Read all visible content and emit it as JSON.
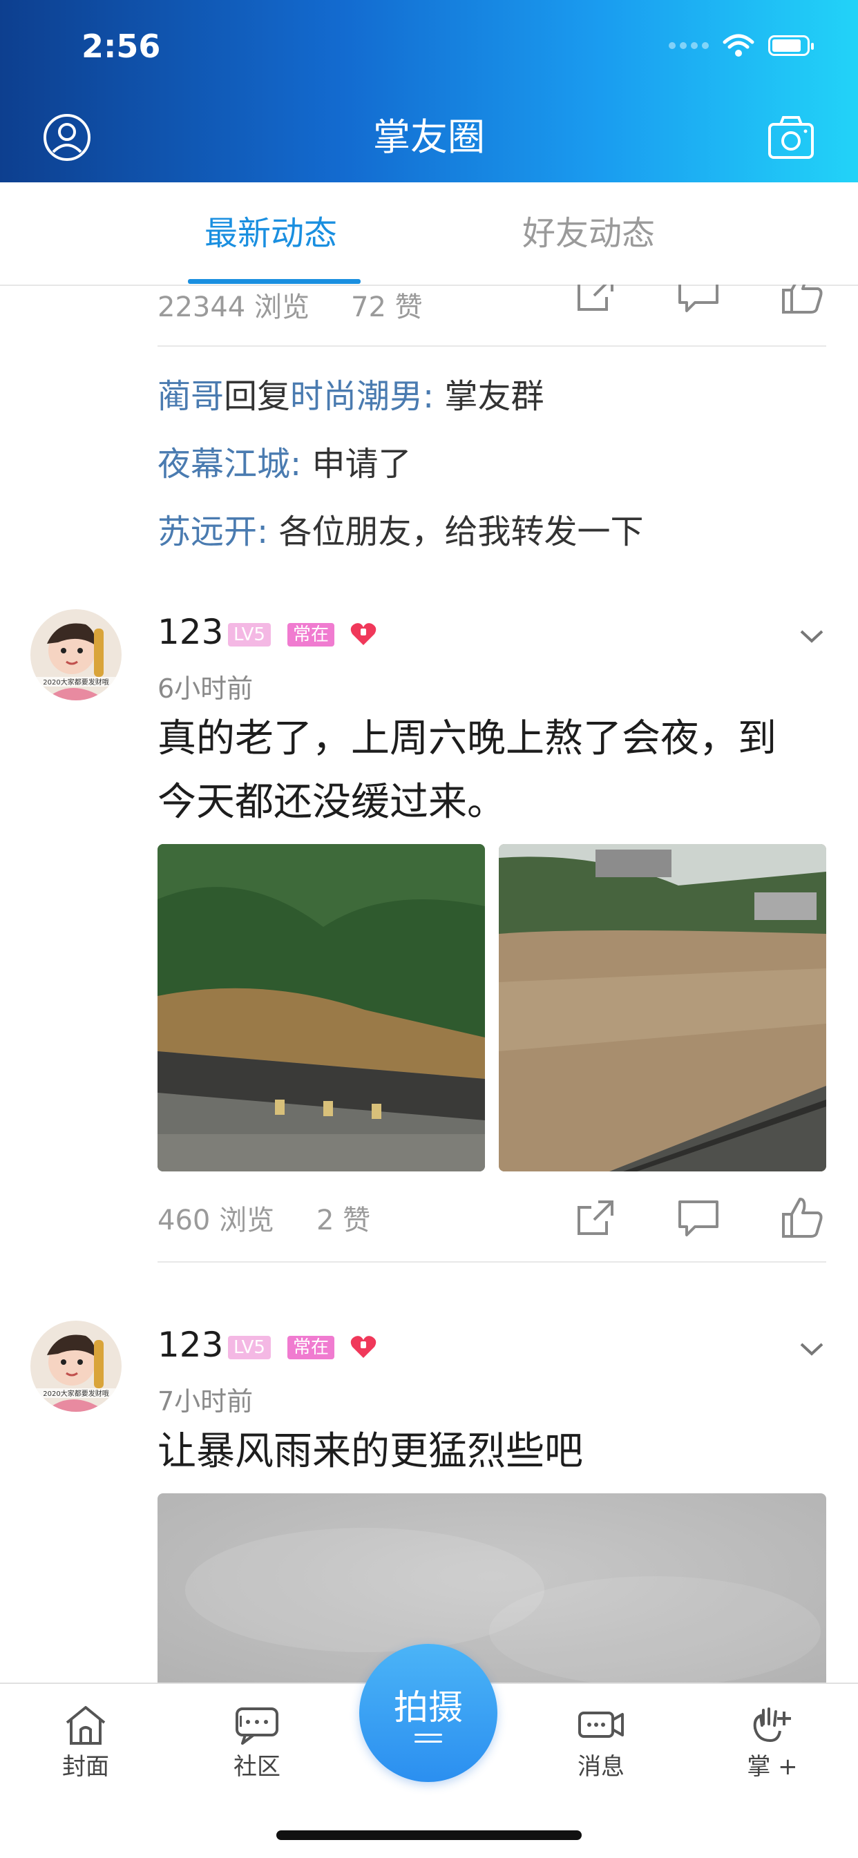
{
  "status_bar": {
    "time": "2:56"
  },
  "header": {
    "title": "掌友圈"
  },
  "tabs": [
    {
      "label": "最新动态",
      "active": true
    },
    {
      "label": "好友动态",
      "active": false
    }
  ],
  "feed": {
    "prev_post": {
      "views": "22344 浏览",
      "likes": "72 赞",
      "comments": [
        {
          "name": "蔺哥",
          "reply_word": "回复",
          "target": "时尚潮男:",
          "text": " 掌友群"
        },
        {
          "name": "夜幕江城:",
          "text": " 申请了"
        },
        {
          "name": "苏远开:",
          "text": " 各位朋友，给我转发一下"
        }
      ]
    },
    "posts": [
      {
        "username": "123",
        "level": "LV5",
        "status": "常在",
        "time": "6小时前",
        "text_line1": "真的老了，上周六晚上熬了会夜，到",
        "text_line2": "今天都还没缓过来。",
        "views": "460 浏览",
        "likes": "2 赞",
        "avatar_caption": "2020大家都要发财哦"
      },
      {
        "username": "123",
        "level": "LV5",
        "status": "常在",
        "time": "7小时前",
        "text_line1": "让暴风雨来的更猛烈些吧",
        "avatar_caption": "2020大家都要发财哦"
      }
    ]
  },
  "bottom_nav": {
    "items": [
      {
        "label": "封面",
        "icon": "home-icon"
      },
      {
        "label": "社区",
        "icon": "chat-icon"
      },
      {
        "label": "消息",
        "icon": "video-message-icon"
      },
      {
        "label": "掌 +",
        "icon": "palm-plus-icon"
      }
    ],
    "center_button": "拍摄"
  },
  "colors": {
    "accent": "#1a8fe0",
    "name_link": "#4a7bb0",
    "header_gradient_start": "#0d3f8f",
    "header_gradient_end": "#22d3f8"
  }
}
